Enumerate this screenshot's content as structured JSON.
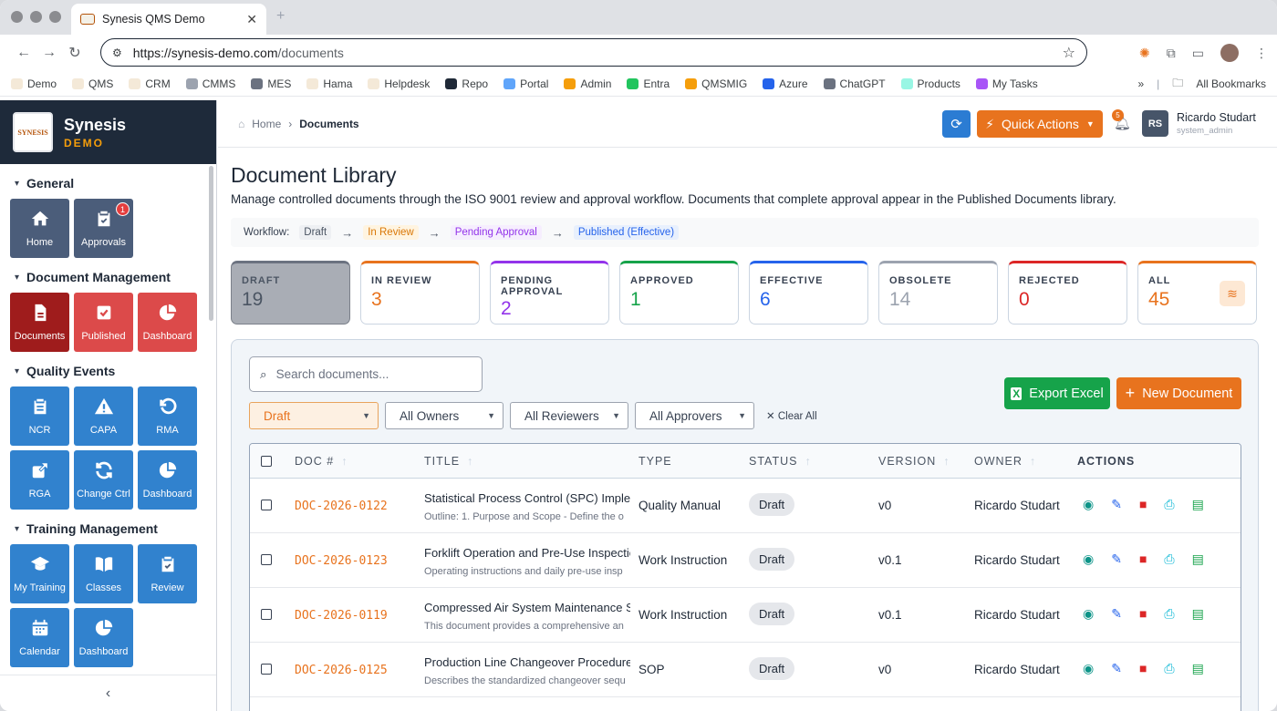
{
  "browser": {
    "tab_title": "Synesis QMS Demo",
    "url_host": "https://synesis-demo.com",
    "url_path": "/documents",
    "bookmarks": [
      {
        "label": "Demo",
        "color": "#f4e9d8"
      },
      {
        "label": "QMS",
        "color": "#f4e9d8"
      },
      {
        "label": "CRM",
        "color": "#f4e9d8"
      },
      {
        "label": "CMMS",
        "color": "#9ca3af"
      },
      {
        "label": "MES",
        "color": "#6b7280"
      },
      {
        "label": "Hama",
        "color": "#f4e9d8"
      },
      {
        "label": "Helpdesk",
        "color": "#f4e9d8"
      },
      {
        "label": "Repo",
        "color": "#1f2937"
      },
      {
        "label": "Portal",
        "color": "#60a5fa"
      },
      {
        "label": "Admin",
        "color": "#f59e0b"
      },
      {
        "label": "Entra",
        "color": "#22c55e"
      },
      {
        "label": "QMSMIG",
        "color": "#f59e0b"
      },
      {
        "label": "Azure",
        "color": "#2563eb"
      },
      {
        "label": "ChatGPT",
        "color": "#6b7280"
      },
      {
        "label": "Products",
        "color": "#99f6e4"
      },
      {
        "label": "My Tasks",
        "color": "#a855f7"
      }
    ],
    "all_bookmarks": "All Bookmarks"
  },
  "brand": {
    "name": "Synesis",
    "sub": "DEMO",
    "logo_text": "SYNESIS"
  },
  "sidebar": {
    "sections": [
      {
        "title": "General",
        "tiles": [
          {
            "label": "Home",
            "icon": "home-icon",
            "color": "slate"
          },
          {
            "label": "Approvals",
            "icon": "clipboard-check-icon",
            "color": "slate",
            "badge": "1"
          }
        ]
      },
      {
        "title": "Document Management",
        "tiles": [
          {
            "label": "Documents",
            "icon": "document-icon",
            "color": "dred"
          },
          {
            "label": "Published",
            "icon": "check-square-icon",
            "color": "red"
          },
          {
            "label": "Dashboard",
            "icon": "pie-chart-icon",
            "color": "red"
          }
        ]
      },
      {
        "title": "Quality Events",
        "tiles": [
          {
            "label": "NCR",
            "icon": "clipboard-list-icon",
            "color": "blue"
          },
          {
            "label": "CAPA",
            "icon": "warning-icon",
            "color": "blue"
          },
          {
            "label": "RMA",
            "icon": "undo-icon",
            "color": "blue"
          },
          {
            "label": "RGA",
            "icon": "share-icon",
            "color": "blue"
          },
          {
            "label": "Change Ctrl",
            "icon": "sync-icon",
            "color": "blue"
          },
          {
            "label": "Dashboard",
            "icon": "pie-chart-icon",
            "color": "blue"
          }
        ]
      },
      {
        "title": "Training Management",
        "tiles": [
          {
            "label": "My Training",
            "icon": "graduation-cap-icon",
            "color": "blue"
          },
          {
            "label": "Classes",
            "icon": "book-icon",
            "color": "blue"
          },
          {
            "label": "Review",
            "icon": "clipboard-check-icon",
            "color": "blue"
          },
          {
            "label": "Calendar",
            "icon": "calendar-icon",
            "color": "blue"
          },
          {
            "label": "Dashboard",
            "icon": "pie-chart-icon",
            "color": "blue"
          }
        ]
      }
    ]
  },
  "header": {
    "breadcrumb_home": "Home",
    "breadcrumb_current": "Documents",
    "quick_actions": "Quick Actions",
    "notif_count": "5",
    "user_initials": "RS",
    "user_name": "Ricardo Studart",
    "user_role": "system_admin"
  },
  "page": {
    "title": "Document Library",
    "description": "Manage controlled documents through the ISO 9001 review and approval workflow. Documents that complete approval appear in the Published Documents library."
  },
  "workflow": {
    "label": "Workflow:",
    "steps": [
      {
        "label": "Draft",
        "color": "#4b5563",
        "bg": "#eef0f3"
      },
      {
        "label": "In Review",
        "color": "#d97706",
        "bg": "#fff4e0"
      },
      {
        "label": "Pending Approval",
        "color": "#9333ea",
        "bg": "#f6eefe"
      },
      {
        "label": "Published (Effective)",
        "color": "#2563eb",
        "bg": "#e8f0fd"
      }
    ]
  },
  "status_cards": [
    {
      "label": "DRAFT",
      "value": "19",
      "color": "#6b7280",
      "selected": true
    },
    {
      "label": "IN REVIEW",
      "value": "3",
      "color": "#e8731e"
    },
    {
      "label": "PENDING APPROVAL",
      "value": "2",
      "color": "#9333ea"
    },
    {
      "label": "APPROVED",
      "value": "1",
      "color": "#16a34a"
    },
    {
      "label": "EFFECTIVE",
      "value": "6",
      "color": "#2563eb"
    },
    {
      "label": "OBSOLETE",
      "value": "14",
      "color": "#9ca3af"
    },
    {
      "label": "REJECTED",
      "value": "0",
      "color": "#dc2626"
    },
    {
      "label": "ALL",
      "value": "45",
      "color": "#e8731e"
    }
  ],
  "filters": {
    "search_placeholder": "Search documents...",
    "status": "Draft",
    "owners": "All Owners",
    "reviewers": "All Reviewers",
    "approvers": "All Approvers",
    "clear": "Clear All",
    "export": "Export Excel",
    "new_doc": "New Document"
  },
  "table": {
    "columns": [
      "DOC #",
      "TITLE",
      "TYPE",
      "STATUS",
      "VERSION",
      "OWNER",
      "ACTIONS"
    ],
    "rows": [
      {
        "doc": "DOC-2026-0122",
        "title": "Statistical Process Control (SPC) Implem",
        "sub": "Outline: 1. Purpose and Scope - Define the o",
        "type": "Quality Manual",
        "status": "Draft",
        "version": "v0",
        "owner": "Ricardo Studart"
      },
      {
        "doc": "DOC-2026-0123",
        "title": "Forklift Operation and Pre-Use Inspectio",
        "sub": "Operating instructions and daily pre-use insp",
        "type": "Work Instruction",
        "status": "Draft",
        "version": "v0.1",
        "owner": "Ricardo Studart"
      },
      {
        "doc": "DOC-2026-0119",
        "title": "Compressed Air System Maintenance Sc",
        "sub": "This document provides a comprehensive an",
        "type": "Work Instruction",
        "status": "Draft",
        "version": "v0.1",
        "owner": "Ricardo Studart"
      },
      {
        "doc": "DOC-2026-0125",
        "title": "Production Line Changeover Procedure",
        "sub": "Describes the standardized changeover sequ",
        "type": "SOP",
        "status": "Draft",
        "version": "v0",
        "owner": "Ricardo Studart"
      }
    ]
  }
}
